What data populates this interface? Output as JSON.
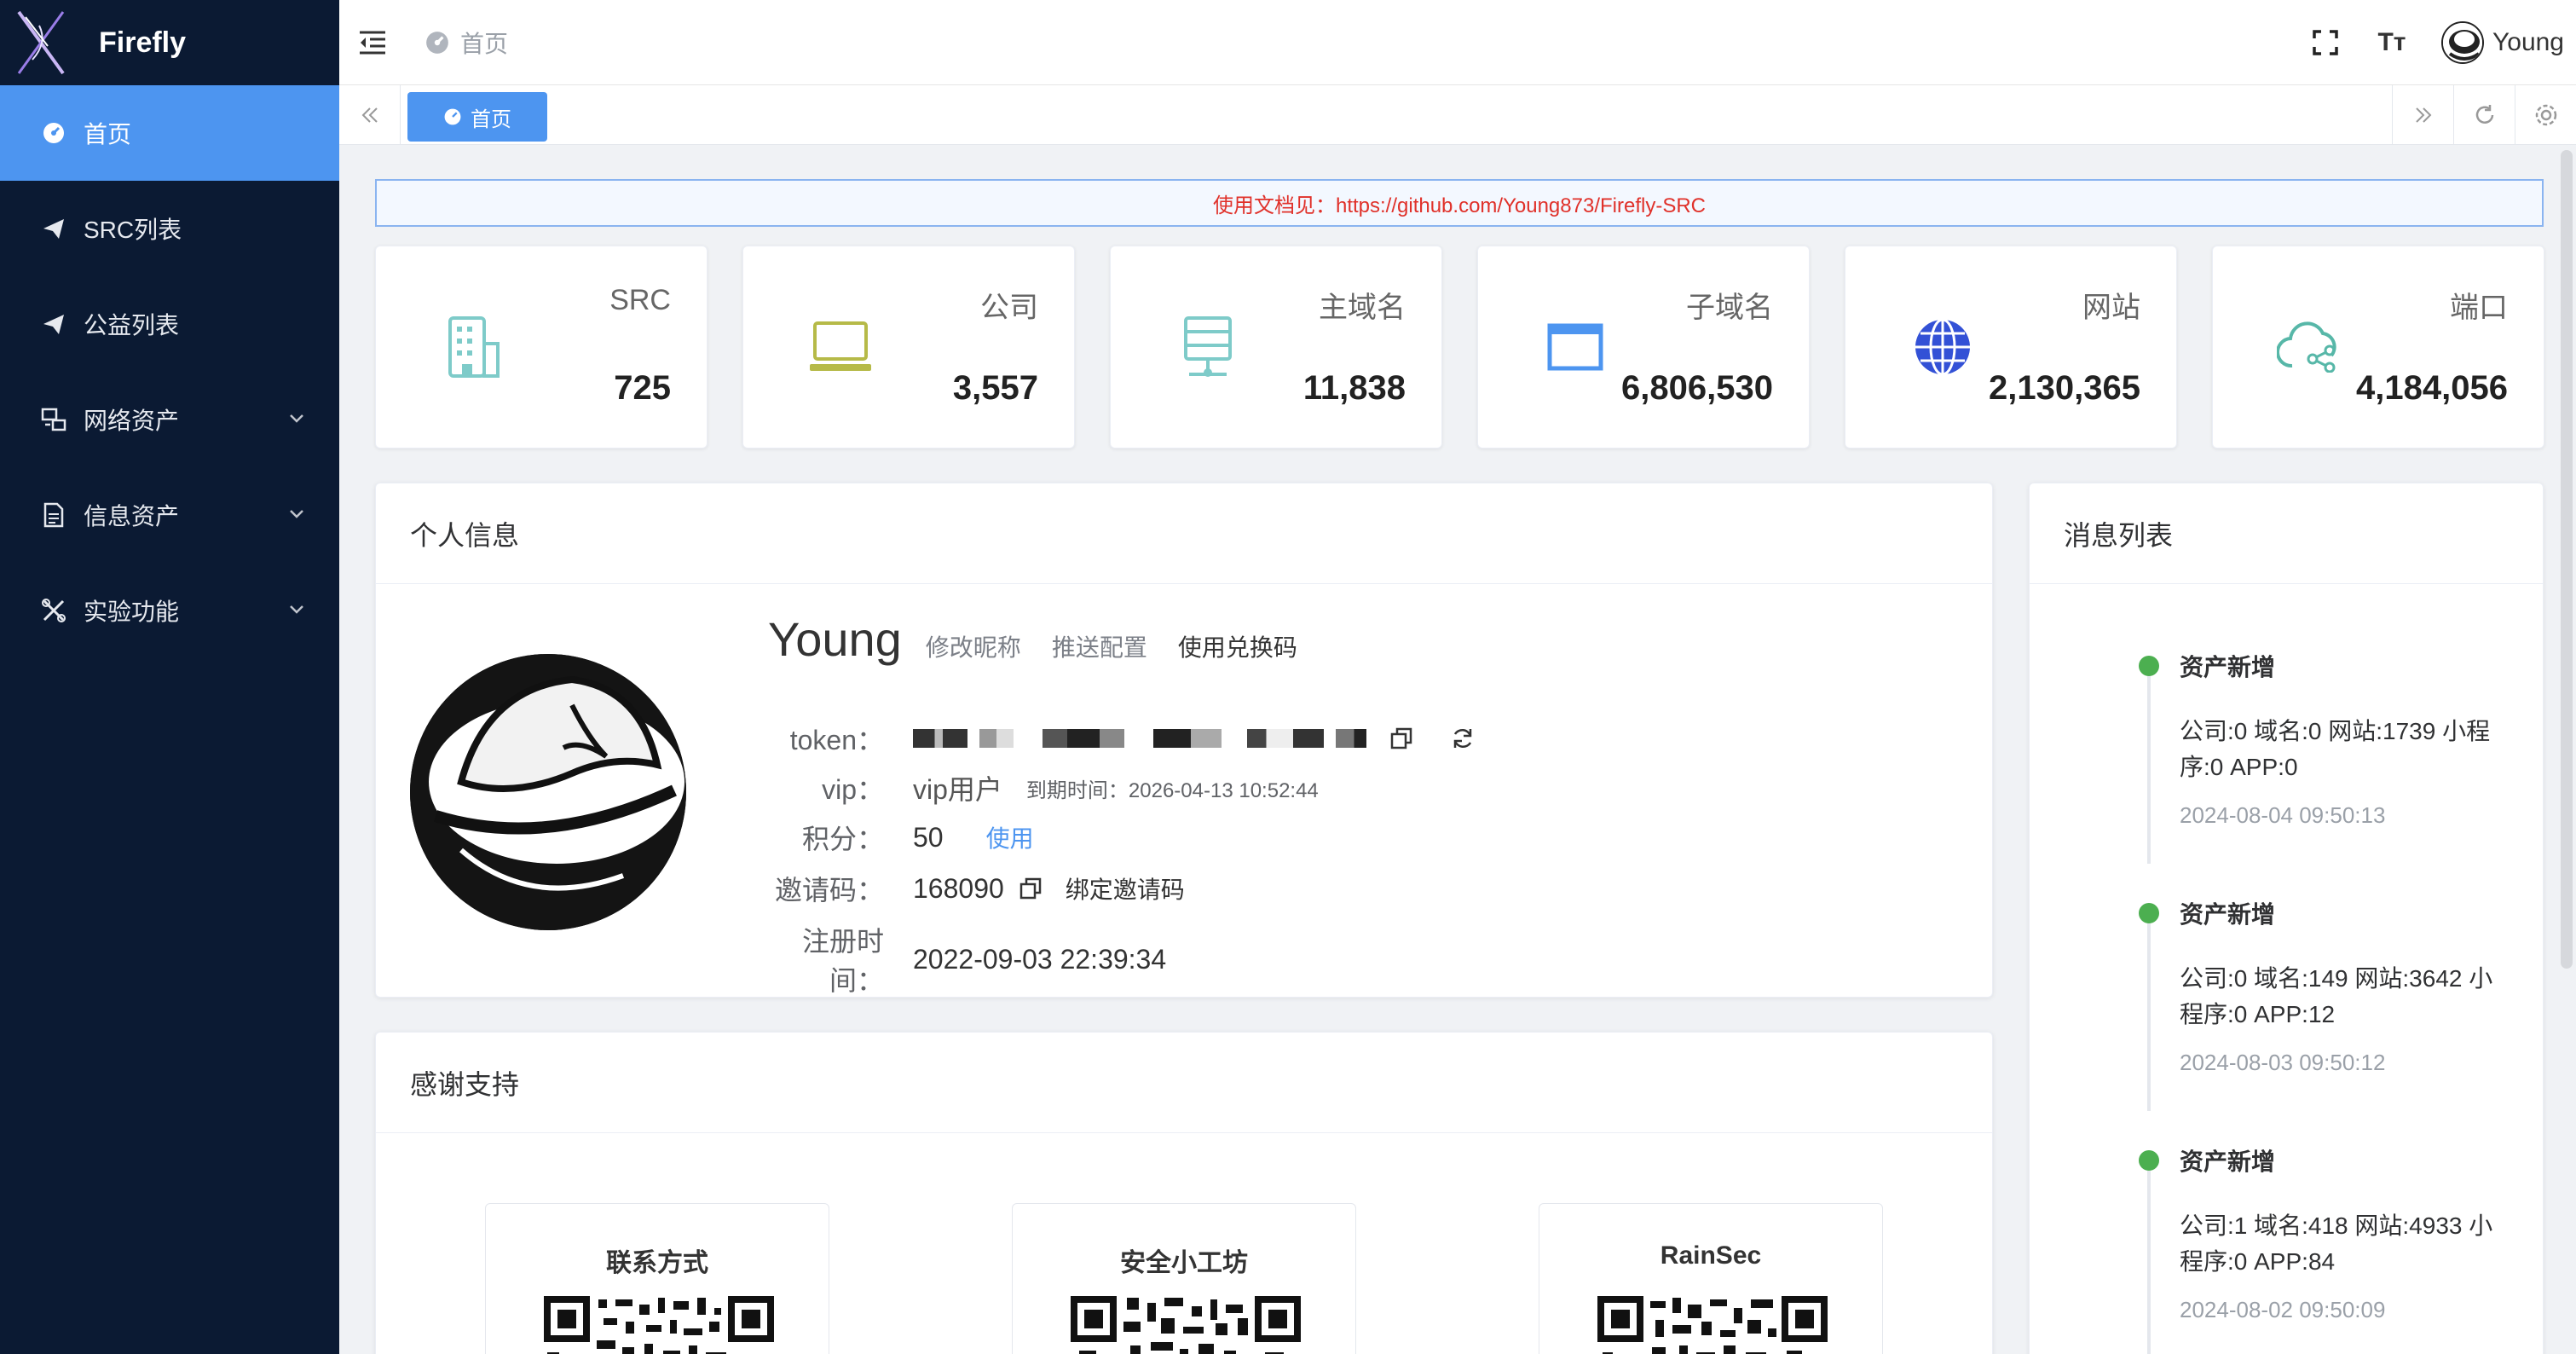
{
  "app": {
    "name": "Firefly"
  },
  "sidebar": {
    "items": [
      {
        "label": "首页",
        "icon": "dashboard-icon",
        "active": true
      },
      {
        "label": "SRC列表",
        "icon": "send-icon"
      },
      {
        "label": "公益列表",
        "icon": "send-icon"
      },
      {
        "label": "网络资产",
        "icon": "network-asset-icon",
        "expandable": true
      },
      {
        "label": "信息资产",
        "icon": "document-icon",
        "expandable": true
      },
      {
        "label": "实验功能",
        "icon": "tools-icon",
        "expandable": true
      }
    ]
  },
  "navbar": {
    "breadcrumb": "首页",
    "font_size_glyph": "Tт",
    "username": "Young"
  },
  "tabs": {
    "active": "首页"
  },
  "notice": "使用文档见：https://github.com/Young873/Firefly-SRC",
  "stats": [
    {
      "label": "SRC",
      "value": "725",
      "icon": "building-icon",
      "color": "#7ecbc9"
    },
    {
      "label": "公司",
      "value": "3,557",
      "icon": "laptop-icon",
      "color": "#b6ba48"
    },
    {
      "label": "主域名",
      "value": "11,838",
      "icon": "server-icon",
      "color": "#7ecbc9"
    },
    {
      "label": "子域名",
      "value": "6,806,530",
      "icon": "window-icon",
      "color": "#4d95f0"
    },
    {
      "label": "网站",
      "value": "2,130,365",
      "icon": "globe-icon",
      "color": "#3351d6"
    },
    {
      "label": "端口",
      "value": "4,184,056",
      "icon": "cloud-share-icon",
      "color": "#57b7a8"
    }
  ],
  "profile": {
    "title": "个人信息",
    "name": "Young",
    "links": {
      "edit_nickname": "修改昵称",
      "push_config": "推送配置",
      "redeem": "使用兑换码"
    },
    "token_label": "token：",
    "vip_label": "vip：",
    "vip_value": "vip用户",
    "expire_text": "到期时间：2026-04-13 10:52:44",
    "points_label": "积分：",
    "points_value": "50",
    "points_use": "使用",
    "invite_label": "邀请码：",
    "invite_value": "168090",
    "bind_invite": "绑定邀请码",
    "register_label": "注册时间：",
    "register_value": "2022-09-03 22:39:34"
  },
  "messages": {
    "title": "消息列表",
    "items": [
      {
        "title": "资产新增",
        "body": "公司:0 域名:0 网站:1739 小程序:0 APP:0",
        "time": "2024-08-04 09:50:13"
      },
      {
        "title": "资产新增",
        "body": "公司:0 域名:149 网站:3642 小程序:0 APP:12",
        "time": "2024-08-03 09:50:12"
      },
      {
        "title": "资产新增",
        "body": "公司:1 域名:418 网站:4933 小程序:0 APP:84",
        "time": "2024-08-02 09:50:09"
      }
    ]
  },
  "support": {
    "title": "感谢支持",
    "cards": [
      {
        "title": "联系方式"
      },
      {
        "title": "安全小工坊"
      },
      {
        "title": "RainSec"
      }
    ]
  },
  "colors": {
    "sidebar_bg": "#0b1a33",
    "accent": "#4d95f0",
    "notice_text": "#e0312a",
    "timeline_dot": "#4caf50"
  }
}
